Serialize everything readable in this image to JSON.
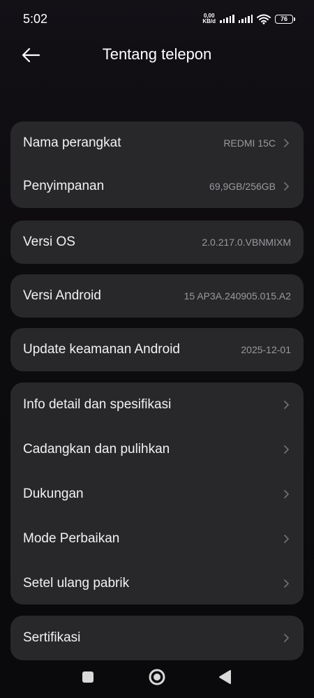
{
  "status_bar": {
    "time": "5:02",
    "net_speed_value": "0,00",
    "net_speed_unit": "KB/d",
    "battery": "76",
    "icons": [
      "signal-icon",
      "signal-icon",
      "wifi-icon",
      "battery-icon"
    ]
  },
  "header": {
    "title": "Tentang telepon",
    "back_icon": "arrow-left-icon"
  },
  "device_card": {
    "items": [
      {
        "label": "Nama perangkat",
        "value": "REDMI 15C"
      },
      {
        "label": "Penyimpanan",
        "value": "69,9GB/256GB"
      }
    ]
  },
  "os_card": {
    "label": "Versi OS",
    "value": "2.0.217.0.VBNMIXM"
  },
  "android_card": {
    "label": "Versi Android",
    "value": "15 AP3A.240905.015.A2"
  },
  "security_card": {
    "label": "Update keamanan Android",
    "value": "2025-12-01"
  },
  "menu_card": {
    "items": [
      {
        "label": "Info detail dan spesifikasi"
      },
      {
        "label": "Cadangkan dan pulihkan"
      },
      {
        "label": "Dukungan"
      },
      {
        "label": "Mode Perbaikan"
      },
      {
        "label": "Setel ulang pabrik"
      }
    ]
  },
  "cert_card": {
    "label": "Sertifikasi"
  },
  "nav_bar": {
    "icons": [
      "recents-square-icon",
      "home-circle-icon",
      "back-triangle-icon"
    ]
  },
  "colors": {
    "background": "#0b0b0d",
    "card": "#28282b",
    "text": "#f2f2f2",
    "secondary_text": "#9a9a9e",
    "chevron": "#6f6f74"
  }
}
